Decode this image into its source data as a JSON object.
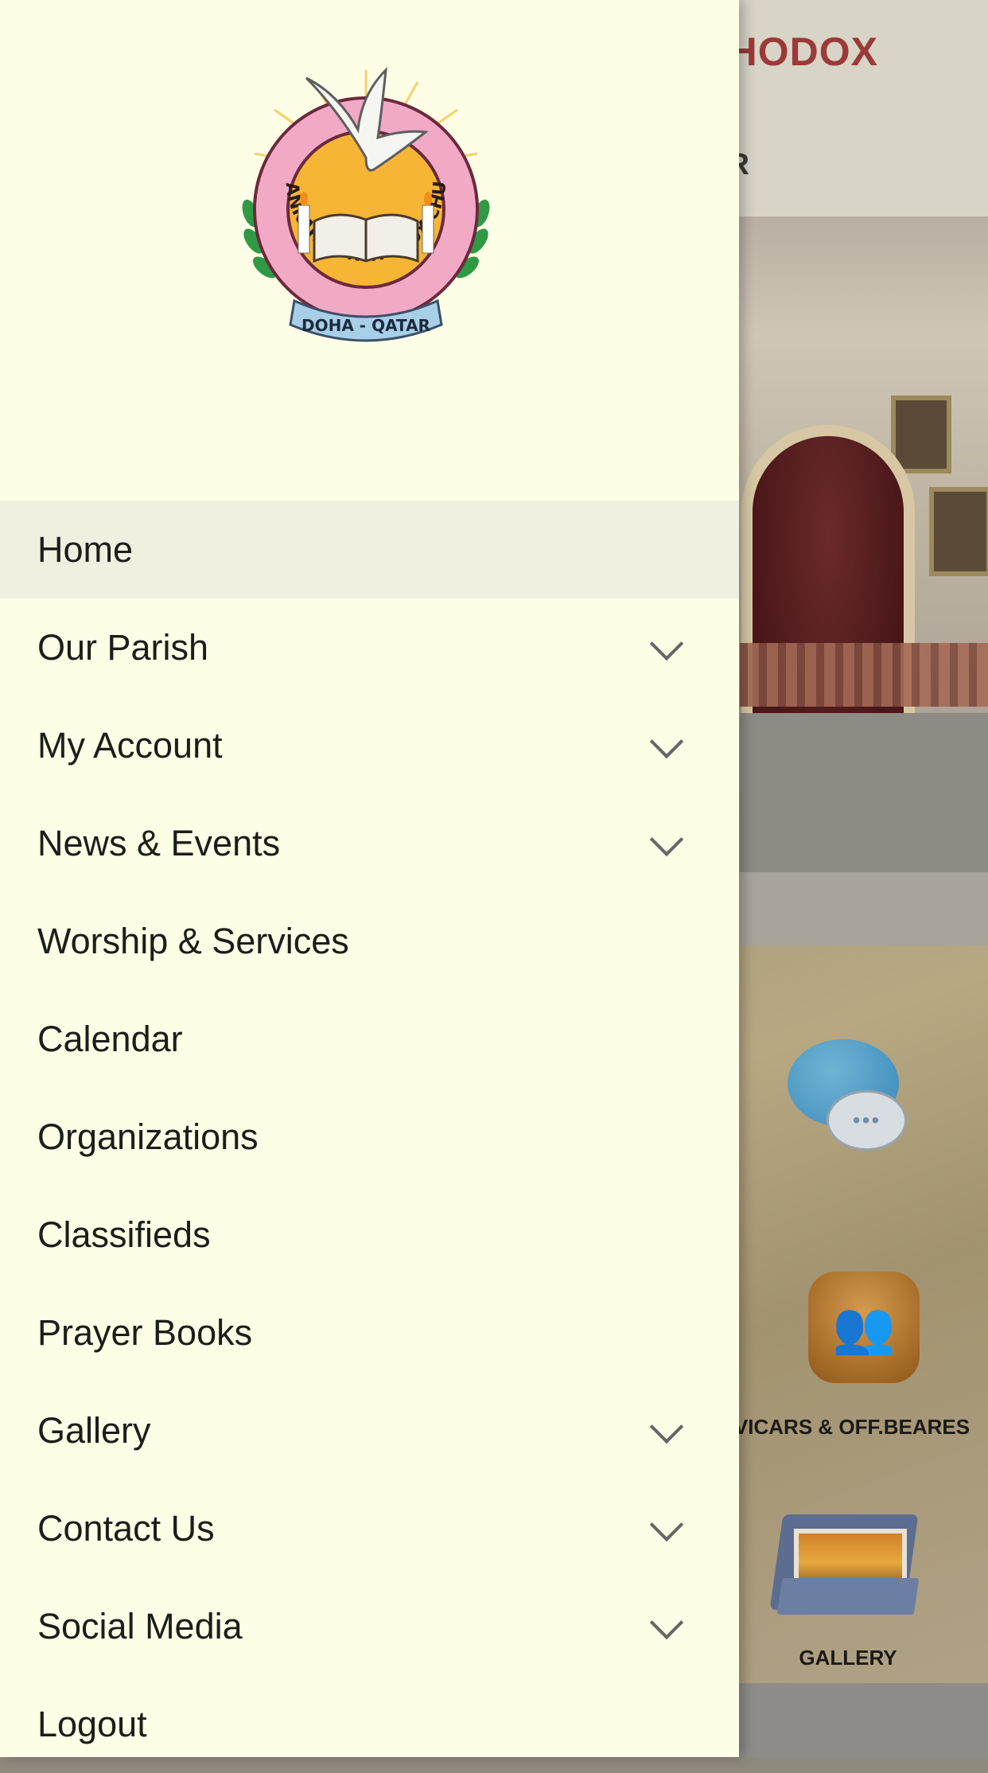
{
  "background_app": {
    "title_fragment": "THODOX",
    "subtitle_fragment": "R",
    "tiles": [
      {
        "label": "CHAT",
        "icon": "chat-bubbles-icon"
      },
      {
        "label": "VICARS & OFF.BEARES",
        "icon": "people-group-icon"
      },
      {
        "label": "GALLERY",
        "icon": "photo-folder-icon"
      }
    ]
  },
  "logo": {
    "arc_text": "MALANKARA ORTHODOX CHURCH",
    "banner_text": "DOHA - QATAR"
  },
  "menu": {
    "items": [
      {
        "label": "Home",
        "expandable": false,
        "active": true
      },
      {
        "label": "Our Parish",
        "expandable": true
      },
      {
        "label": "My Account",
        "expandable": true
      },
      {
        "label": "News & Events",
        "expandable": true
      },
      {
        "label": "Worship & Services",
        "expandable": false
      },
      {
        "label": "Calendar",
        "expandable": false
      },
      {
        "label": "Organizations",
        "expandable": false
      },
      {
        "label": "Classifieds",
        "expandable": false
      },
      {
        "label": "Prayer Books",
        "expandable": false
      },
      {
        "label": "Gallery",
        "expandable": true
      },
      {
        "label": "Contact Us",
        "expandable": true
      },
      {
        "label": "Social Media",
        "expandable": true
      },
      {
        "label": "Logout",
        "expandable": false
      }
    ]
  },
  "colors": {
    "drawer_bg": "#fefee6",
    "active_bg": "#f0f0e1",
    "title_red": "#9b3a38"
  }
}
